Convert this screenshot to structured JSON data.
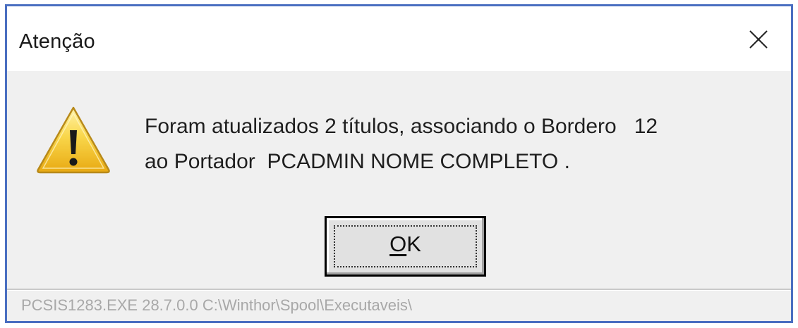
{
  "dialog": {
    "title": "Atenção",
    "icon": "warning-icon",
    "message_line1": "Foram atualizados 2 títulos, associando o Bordero   12",
    "message_line2": "ao Portador  PCADMIN NOME COMPLETO .",
    "ok_mnemonic": "O",
    "ok_rest": "K",
    "status_text": "PCSIS1283.EXE 28.7.0.0 C:\\Winthor\\Spool\\Executaveis\\"
  },
  "colors": {
    "frame_border": "#4a6fc1",
    "dialog_background": "#f0f0f0",
    "titlebar_background": "#ffffff",
    "warning_yellow": "#f5c518"
  }
}
